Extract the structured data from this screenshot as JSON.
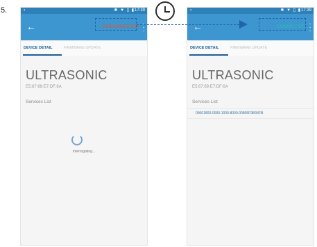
{
  "step_number": "5.",
  "colors": {
    "toolbar": "#3e96d0",
    "status_bar": "#2e80b8",
    "disconnected": "#e8542a",
    "connected": "#28c0a8",
    "annotation": "#1f63aa"
  },
  "annotations": {
    "clock_icon": "clock-icon",
    "arrow_direction": "left-to-right"
  },
  "screens": {
    "before": {
      "status_time": "17:39",
      "status_icons": "✱ ▼ ▯ ▮",
      "back_icon": "back-arrow-icon",
      "connection_action": "DISCONNECTED",
      "tabs": [
        "DEVICE DETAIL",
        "FIRMWARE UPDATE"
      ],
      "device_name": "ULTRASONIC",
      "device_address": "E5:67:69:E7:DF:6A",
      "services_label": "Services List",
      "loading_text": "Interrogating..."
    },
    "after": {
      "status_time": "17:39",
      "status_icons": "✱ ▼ ▯ ▮",
      "back_icon": "back-arrow-icon",
      "connection_action": "CONNECTED",
      "tabs": [
        "DEVICE DETAIL",
        "FIRMWARE UPDATE"
      ],
      "device_name": "ULTRASONIC",
      "device_address": "E5:67:69:E7:DF:6A",
      "services_label": "Services List",
      "services": [
        "00001800-0000-1000-8000-00805F9B34FB"
      ]
    }
  }
}
